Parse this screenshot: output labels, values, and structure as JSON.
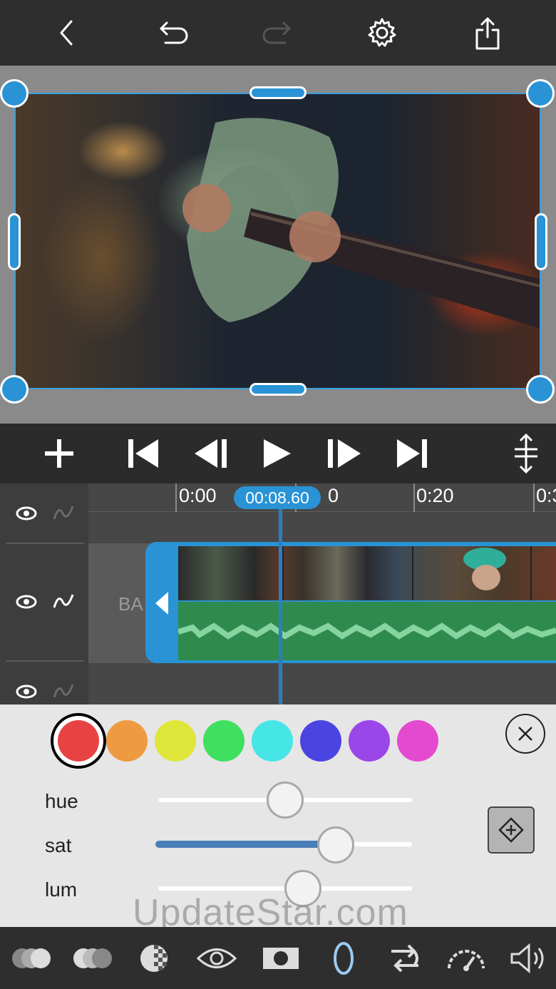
{
  "toolbar": {
    "icons": [
      "back-icon",
      "undo-icon",
      "redo-icon",
      "settings-icon",
      "share-icon"
    ]
  },
  "timeline": {
    "ruler_ticks": [
      "0:00",
      "0",
      "0:20",
      "0:3"
    ],
    "current_time": "00:08.60",
    "track_label": "BA"
  },
  "color_panel": {
    "swatches": [
      {
        "name": "red",
        "color": "#e84343",
        "selected": true
      },
      {
        "name": "orange",
        "color": "#ee9a40"
      },
      {
        "name": "yellow",
        "color": "#dfe63a"
      },
      {
        "name": "green",
        "color": "#3fe060"
      },
      {
        "name": "cyan",
        "color": "#46e6e6"
      },
      {
        "name": "blue",
        "color": "#4a45e0"
      },
      {
        "name": "purple",
        "color": "#9a46e8"
      },
      {
        "name": "magenta",
        "color": "#e44ad0"
      }
    ],
    "sliders": [
      {
        "label": "hue",
        "value": 0.5
      },
      {
        "label": "sat",
        "value": 0.7
      },
      {
        "label": "lum",
        "value": 0.57
      }
    ]
  },
  "watermark": "UpdateStar.com",
  "colors": {
    "accent": "#2a93d5",
    "audio_wave": "#2f8a4e",
    "toolbar_bg": "#2e2e2e"
  }
}
